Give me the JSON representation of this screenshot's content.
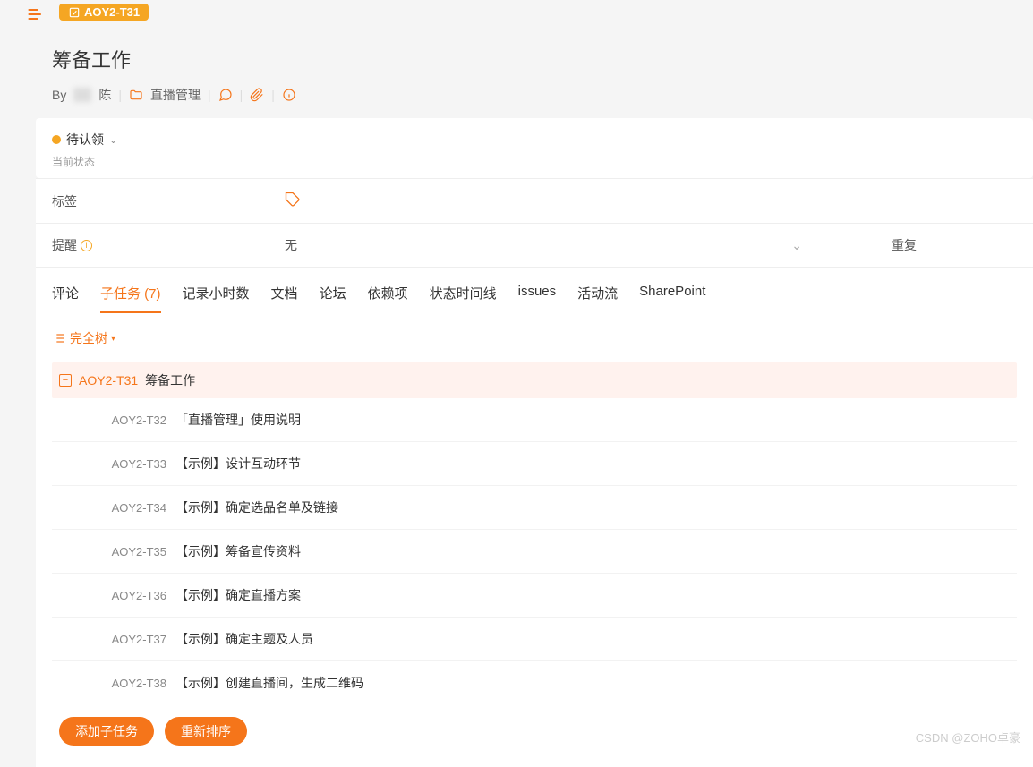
{
  "task": {
    "badge_id": "AOY2-T31",
    "title": "筹备工作",
    "by_label": "By",
    "author": "陈",
    "folder": "直播管理"
  },
  "status": {
    "text": "待认领",
    "label": "当前状态"
  },
  "fields": {
    "tag_label": "标签",
    "remind_label": "提醒",
    "remind_value": "无",
    "repeat_label": "重复"
  },
  "tabs": [
    {
      "label": "评论"
    },
    {
      "label": "子任务 (7)",
      "active": true
    },
    {
      "label": "记录小时数"
    },
    {
      "label": "文档"
    },
    {
      "label": "论坛"
    },
    {
      "label": "依赖项"
    },
    {
      "label": "状态时间线"
    },
    {
      "label": "issues"
    },
    {
      "label": "活动流"
    },
    {
      "label": "SharePoint"
    }
  ],
  "tree": {
    "toggle_label": "完全树",
    "parent_id": "AOY2-T31",
    "parent_title": "筹备工作",
    "subtasks": [
      {
        "id": "AOY2-T32",
        "title": "「直播管理」使用说明"
      },
      {
        "id": "AOY2-T33",
        "title": "【示例】设计互动环节"
      },
      {
        "id": "AOY2-T34",
        "title": "【示例】确定选品名单及链接"
      },
      {
        "id": "AOY2-T35",
        "title": "【示例】筹备宣传资料"
      },
      {
        "id": "AOY2-T36",
        "title": "【示例】确定直播方案"
      },
      {
        "id": "AOY2-T37",
        "title": "【示例】确定主题及人员"
      },
      {
        "id": "AOY2-T38",
        "title": "【示例】创建直播间，生成二维码"
      }
    ]
  },
  "actions": {
    "add_subtask": "添加子任务",
    "reorder": "重新排序"
  },
  "watermark": "CSDN @ZOHO卓豪"
}
